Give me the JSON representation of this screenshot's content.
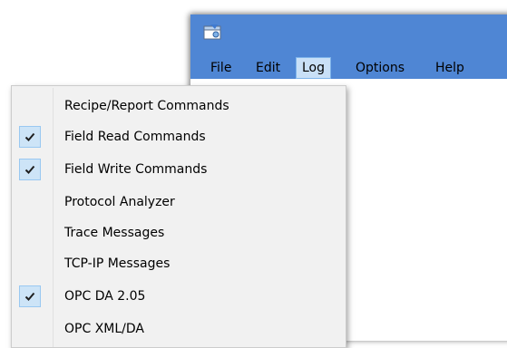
{
  "menubar": {
    "items": [
      {
        "label": "File"
      },
      {
        "label": "Edit"
      },
      {
        "label": "Log"
      },
      {
        "label": "Options"
      },
      {
        "label": "Help"
      }
    ],
    "active": "Log"
  },
  "log_menu": {
    "items": [
      {
        "label": "Recipe/Report Commands",
        "checked": false
      },
      {
        "label": "Field Read Commands",
        "checked": true
      },
      {
        "label": "Field Write Commands",
        "checked": true
      },
      {
        "label": "Protocol Analyzer",
        "checked": false
      },
      {
        "label": "Trace Messages",
        "checked": false
      },
      {
        "label": "TCP-IP Messages",
        "checked": false
      },
      {
        "label": "OPC DA 2.05",
        "checked": true
      },
      {
        "label": "OPC XML/DA",
        "checked": false
      }
    ]
  },
  "colors": {
    "titlebar": "#4f86d4",
    "menu_bg": "#f1f1f1",
    "highlight": "#c9e0f7",
    "check_bg": "#cde4f7"
  },
  "icons": {
    "app": "app-icon",
    "check": "check-icon"
  }
}
